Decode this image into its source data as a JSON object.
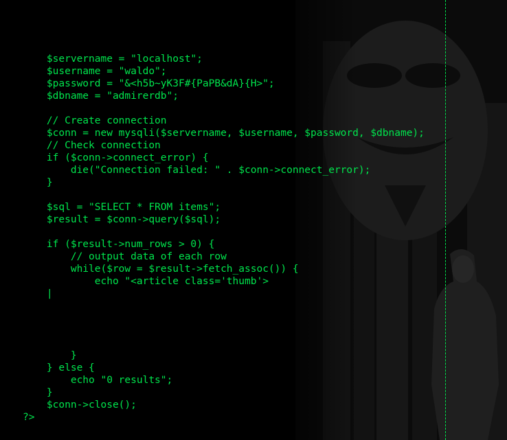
{
  "theme": {
    "background": "#000000",
    "text_color": "#00e64d"
  },
  "editor": {
    "lines": [
      "    $servername = \"localhost\";",
      "    $username = \"waldo\";",
      "    $password = \"&<h5b~yK3F#{PaPB&dA}{H>\";",
      "    $dbname = \"admirerdb\";",
      "",
      "    // Create connection",
      "    $conn = new mysqli($servername, $username, $password, $dbname);",
      "    // Check connection",
      "    if ($conn->connect_error) {",
      "        die(\"Connection failed: \" . $conn->connect_error);",
      "    }",
      "",
      "    $sql = \"SELECT * FROM items\";",
      "    $result = $conn->query($sql);",
      "",
      "    if ($result->num_rows > 0) {",
      "        // output data of each row",
      "        while($row = $result->fetch_assoc()) {",
      "            echo \"<article class='thumb'>",
      "    |",
      "",
      "",
      "",
      "",
      "        }",
      "    } else {",
      "        echo \"0 results\";",
      "    }",
      "    $conn->close();",
      "?>"
    ]
  }
}
